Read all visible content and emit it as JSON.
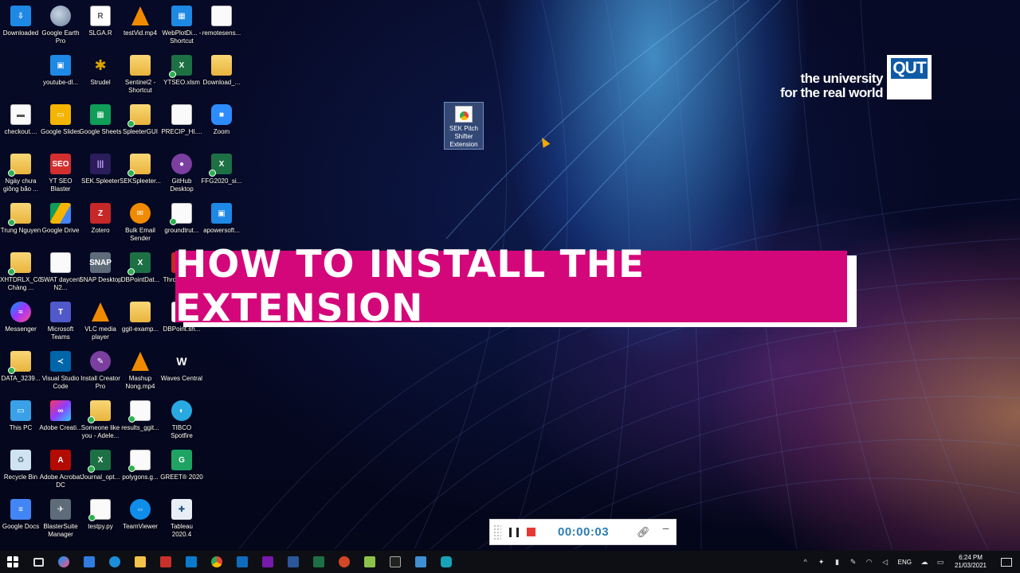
{
  "desktop_icons": [
    {
      "label": "Downloaded",
      "kind": "blue",
      "glyph": "⇩",
      "check": false
    },
    {
      "label": "Google Earth Pro",
      "kind": "globe",
      "glyph": "",
      "check": false
    },
    {
      "label": "SLGA.R",
      "kind": "rstudio",
      "glyph": "R",
      "check": false
    },
    {
      "label": "testVid.mp4",
      "kind": "vlc",
      "glyph": "",
      "check": false
    },
    {
      "label": "WebPlotDi... - Shortcut",
      "kind": "blue",
      "glyph": "▦",
      "check": false
    },
    {
      "label": "remotesens...",
      "kind": "doc",
      "glyph": "",
      "check": false
    },
    {
      "label": "youtube-dl...",
      "kind": "blue",
      "glyph": "▣",
      "check": false
    },
    {
      "label": "Strudel",
      "kind": "strudel",
      "glyph": "✱",
      "check": false
    },
    {
      "label": "Sentinel2 - Shortcut",
      "kind": "folder",
      "glyph": "",
      "check": false
    },
    {
      "label": "YTSEO.xlsm",
      "kind": "excel",
      "glyph": "X",
      "check": true
    },
    {
      "label": "Download_...",
      "kind": "folder",
      "glyph": "",
      "check": false
    },
    {
      "label": "checkout....",
      "kind": "doc",
      "glyph": "▬",
      "check": false
    },
    {
      "label": "Google Slides",
      "kind": "gslide",
      "glyph": "▭",
      "check": false
    },
    {
      "label": "Google Sheets",
      "kind": "gsheet",
      "glyph": "▦",
      "check": false
    },
    {
      "label": "SpleeterGUI",
      "kind": "folder",
      "glyph": "",
      "check": true
    },
    {
      "label": "PRECIP_HI....",
      "kind": "doc",
      "glyph": "",
      "check": false
    },
    {
      "label": "Zoom",
      "kind": "zoom",
      "glyph": "■",
      "check": false
    },
    {
      "label": "Ngày chưa giông bão ...",
      "kind": "folder",
      "glyph": "",
      "check": true
    },
    {
      "label": "YT SEO Blaster",
      "kind": "seo",
      "glyph": "SEO",
      "check": false
    },
    {
      "label": "SEK.Spleeter",
      "kind": "sekbar",
      "glyph": "|||",
      "check": false
    },
    {
      "label": "SEKSpleeter...",
      "kind": "folder",
      "glyph": "",
      "check": true
    },
    {
      "label": "GitHub Desktop",
      "kind": "purple",
      "glyph": "●",
      "check": false
    },
    {
      "label": "FFG2020_si...",
      "kind": "excel",
      "glyph": "X",
      "check": true
    },
    {
      "label": "Trung Nguyen",
      "kind": "folder",
      "glyph": "",
      "check": true
    },
    {
      "label": "Google Drive",
      "kind": "gdrive",
      "glyph": "",
      "check": false
    },
    {
      "label": "Zotero",
      "kind": "red",
      "glyph": "Z",
      "check": false
    },
    {
      "label": "Bulk Email Sender",
      "kind": "orange",
      "glyph": "✉",
      "check": false
    },
    {
      "label": "groundtrut...",
      "kind": "doc",
      "glyph": "",
      "check": true
    },
    {
      "label": "apowersoft...",
      "kind": "blue",
      "glyph": "▣",
      "check": false
    },
    {
      "label": "XHTDRLX_Cô Chàng ...",
      "kind": "folder",
      "glyph": "",
      "check": true
    },
    {
      "label": "SWAT daycent N2...",
      "kind": "doc",
      "glyph": "",
      "check": false
    },
    {
      "label": "SNAP Desktop",
      "kind": "snap",
      "glyph": "SNAP",
      "check": false
    },
    {
      "label": "DBPointDat...",
      "kind": "excel",
      "glyph": "X",
      "check": true
    },
    {
      "label": "Thro... - Sh...",
      "kind": "red",
      "glyph": "",
      "check": false
    },
    {
      "label": "Messenger",
      "kind": "msg",
      "glyph": "≈",
      "check": false
    },
    {
      "label": "Microsoft Teams",
      "kind": "teams",
      "glyph": "T",
      "check": false
    },
    {
      "label": "VLC media player",
      "kind": "vlc",
      "glyph": "",
      "check": false
    },
    {
      "label": "ggit-examp...",
      "kind": "folder",
      "glyph": "",
      "check": false
    },
    {
      "label": "DBPoint.sh...",
      "kind": "doc",
      "glyph": "",
      "check": false
    },
    {
      "label": "DATA_3239...",
      "kind": "folder",
      "glyph": "",
      "check": true
    },
    {
      "label": "Visual Studio Code",
      "kind": "vsc",
      "glyph": "≺",
      "check": false
    },
    {
      "label": "Install Creator Pro",
      "kind": "purple",
      "glyph": "✎",
      "check": false
    },
    {
      "label": "Mashup Nong.mp4",
      "kind": "vlc",
      "glyph": "",
      "check": false
    },
    {
      "label": "Waves Central",
      "kind": "waves",
      "glyph": "W",
      "check": false
    },
    {
      "label": "This PC",
      "kind": "pc",
      "glyph": "▭",
      "check": false
    },
    {
      "label": "Adobe Creati...",
      "kind": "adobe",
      "glyph": "∞",
      "check": false
    },
    {
      "label": "Someone like you - Adele...",
      "kind": "folder",
      "glyph": "",
      "check": true
    },
    {
      "label": "results_ggit...",
      "kind": "doc",
      "glyph": "",
      "check": true
    },
    {
      "label": "TIBCO Spotfire",
      "kind": "sky",
      "glyph": "◐",
      "check": false
    },
    {
      "label": "Recycle Bin",
      "kind": "bin",
      "glyph": "♻",
      "check": false
    },
    {
      "label": "Adobe Acrobat DC",
      "kind": "acrobat",
      "glyph": "A",
      "check": false
    },
    {
      "label": "Journal_opt...",
      "kind": "excel",
      "glyph": "X",
      "check": true
    },
    {
      "label": "polygons.g...",
      "kind": "doc",
      "glyph": "",
      "check": true
    },
    {
      "label": "GREET® 2020",
      "kind": "ggreen",
      "glyph": "G",
      "check": false
    },
    {
      "label": "Google Docs",
      "kind": "gdoc",
      "glyph": "≡",
      "check": false
    },
    {
      "label": "BlasterSuite Manager",
      "kind": "snap",
      "glyph": "✈",
      "check": false
    },
    {
      "label": "testpy.py",
      "kind": "doc",
      "glyph": "",
      "check": true
    },
    {
      "label": "TeamViewer",
      "kind": "tv",
      "glyph": "⇔",
      "check": false
    },
    {
      "label": "Tableau 2020.4",
      "kind": "tab",
      "glyph": "✚",
      "check": false
    }
  ],
  "selected_icon": {
    "label": "SEK Pitch Shifter Extension"
  },
  "branding": {
    "line1": "the university",
    "line2": "for the real world",
    "logo": "QUT"
  },
  "banner": {
    "title": "HOW TO INSTALL THE EXTENSION",
    "color": "#d4077a"
  },
  "recorder": {
    "time": "00:00:03",
    "link_icon": "link-icon",
    "minimize": "–"
  },
  "taskbar": {
    "apps": [
      "start-icon",
      "task-view-icon",
      "app-icon",
      "todo-icon",
      "app-icon",
      "file-explorer-icon",
      "app-icon",
      "vscode-icon",
      "chrome-icon",
      "outlook-icon",
      "onenote-icon",
      "word-icon",
      "excel-icon",
      "powerpoint-icon",
      "app-icon",
      "terminal-icon",
      "app-icon",
      "camera-icon"
    ],
    "tray": {
      "lang": "ENG",
      "time": "6:24 PM",
      "date": "21/03/2021"
    }
  }
}
